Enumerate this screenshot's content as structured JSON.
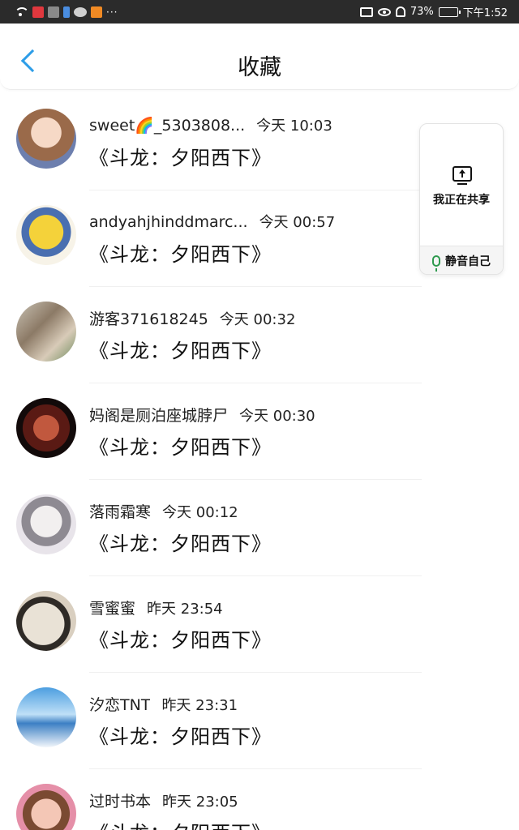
{
  "status_bar": {
    "battery_percent": "73%",
    "time": "下午1:52",
    "dots": "···",
    "battery_level": 0.73
  },
  "header": {
    "title": "收藏"
  },
  "list": {
    "items": [
      {
        "name": "sweet🌈_5303808...",
        "time": "今天 10:03",
        "book": "《斗龙：夕阳西下》"
      },
      {
        "name": "andyahjhinddmarc...",
        "time": "今天 00:57",
        "book": "《斗龙：夕阳西下》"
      },
      {
        "name": "游客371618245",
        "time": "今天 00:32",
        "book": "《斗龙：夕阳西下》"
      },
      {
        "name": "妈阁是厕泊座城脖尸",
        "time": "今天 00:30",
        "book": "《斗龙：夕阳西下》"
      },
      {
        "name": "落雨霜寒",
        "time": "今天 00:12",
        "book": "《斗龙：夕阳西下》"
      },
      {
        "name": "雪蜜蜜",
        "time": "昨天 23:54",
        "book": "《斗龙：夕阳西下》"
      },
      {
        "name": "汐恋TNT",
        "time": "昨天 23:31",
        "book": "《斗龙：夕阳西下》"
      },
      {
        "name": "过时书本",
        "time": "昨天 23:05",
        "book": "《斗龙：夕阳西下》"
      }
    ]
  },
  "share_panel": {
    "share_label": "我正在共享",
    "mute_label": "静音自己"
  },
  "colors": {
    "accent": "#2d9de8",
    "mic": "#2e9a4e",
    "status_bar_bg": "#2b2b2b"
  }
}
